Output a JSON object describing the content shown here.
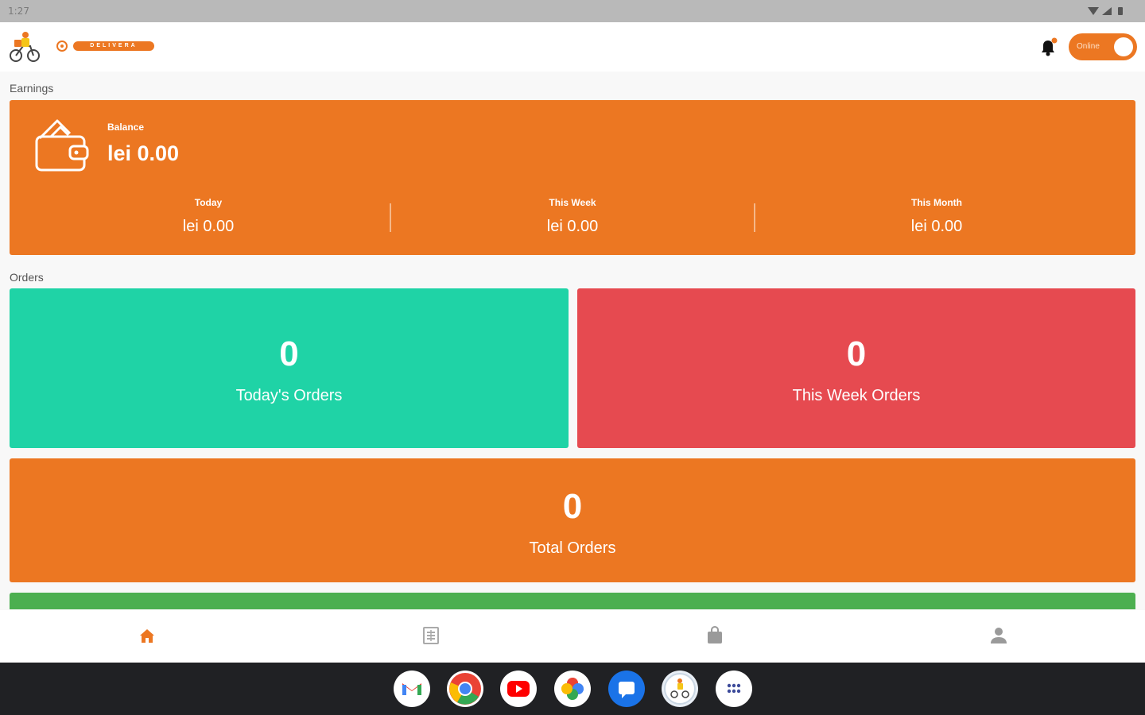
{
  "status_bar": {
    "time": "1:27"
  },
  "header": {
    "brand_text": "DELIVERA",
    "online_toggle_label": "Online",
    "online": true
  },
  "earnings": {
    "section_label": "Earnings",
    "balance_label": "Balance",
    "balance_value": "lei 0.00",
    "periods": [
      {
        "label": "Today",
        "value": "lei 0.00"
      },
      {
        "label": "This Week",
        "value": "lei 0.00"
      },
      {
        "label": "This Month",
        "value": "lei 0.00"
      }
    ]
  },
  "orders": {
    "section_label": "Orders",
    "today": {
      "count": "0",
      "label": "Today's Orders"
    },
    "week": {
      "count": "0",
      "label": "This Week Orders"
    },
    "total": {
      "count": "0",
      "label": "Total Orders"
    }
  },
  "colors": {
    "accent": "#ec7722",
    "today_card": "#1fd3a6",
    "week_card": "#e64a50",
    "strip": "#4caf50"
  },
  "bottom_nav": [
    "home-icon",
    "orders-list-icon",
    "shopping-bag-icon",
    "profile-icon"
  ],
  "dock_apps": [
    "gmail-icon",
    "chrome-icon",
    "youtube-icon",
    "photos-icon",
    "messages-icon",
    "delivera-icon",
    "app-drawer-icon"
  ]
}
